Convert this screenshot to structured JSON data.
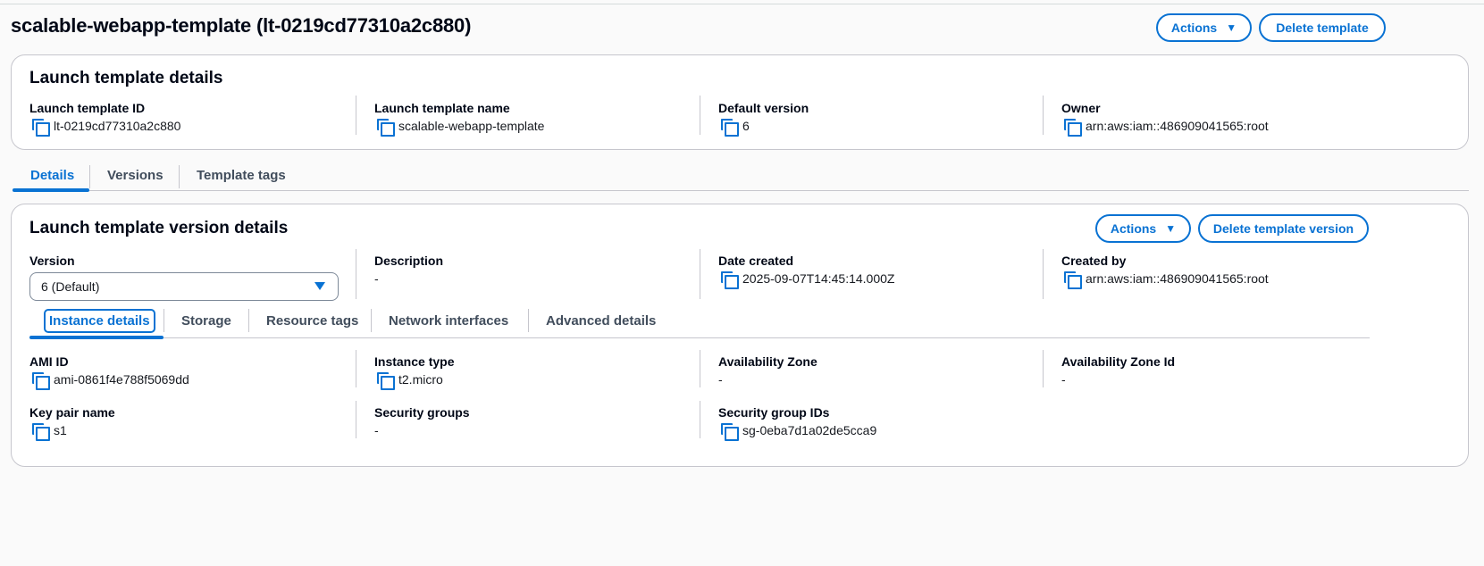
{
  "header": {
    "title": "scalable-webapp-template (lt-0219cd77310a2c880)",
    "actions_label": "Actions",
    "delete_label": "Delete template"
  },
  "template_details": {
    "title": "Launch template details",
    "fields": [
      {
        "label": "Launch template ID",
        "value": "lt-0219cd77310a2c880"
      },
      {
        "label": "Launch template name",
        "value": "scalable-webapp-template"
      },
      {
        "label": "Default version",
        "value": "6"
      },
      {
        "label": "Owner",
        "value": "arn:aws:iam::486909041565:root"
      }
    ]
  },
  "tabs": [
    {
      "label": "Details",
      "active": true
    },
    {
      "label": "Versions",
      "active": false
    },
    {
      "label": "Template tags",
      "active": false
    }
  ],
  "version_details": {
    "title": "Launch template version details",
    "actions_label": "Actions",
    "delete_label": "Delete template version",
    "version_label": "Version",
    "version_selected": "6 (Default)",
    "description_label": "Description",
    "description_value": "-",
    "date_label": "Date created",
    "date_value": "2025-09-07T14:45:14.000Z",
    "created_by_label": "Created by",
    "created_by_value": "arn:aws:iam::486909041565:root",
    "subtabs": [
      {
        "label": "Instance details",
        "active": true
      },
      {
        "label": "Storage",
        "active": false
      },
      {
        "label": "Resource tags",
        "active": false
      },
      {
        "label": "Network interfaces",
        "active": false
      },
      {
        "label": "Advanced details",
        "active": false
      }
    ],
    "instance": {
      "ami_label": "AMI ID",
      "ami_value": "ami-0861f4e788f5069dd",
      "type_label": "Instance type",
      "type_value": "t2.micro",
      "az_label": "Availability Zone",
      "az_value": "-",
      "azid_label": "Availability Zone Id",
      "azid_value": "-",
      "key_label": "Key pair name",
      "key_value": "s1",
      "sg_label": "Security groups",
      "sg_value": "-",
      "sgid_label": "Security group IDs",
      "sgid_value": "sg-0eba7d1a02de5cca9"
    }
  },
  "colors": {
    "accent": "#0972d3",
    "border": "#c6c6cd",
    "text": "#000716"
  }
}
